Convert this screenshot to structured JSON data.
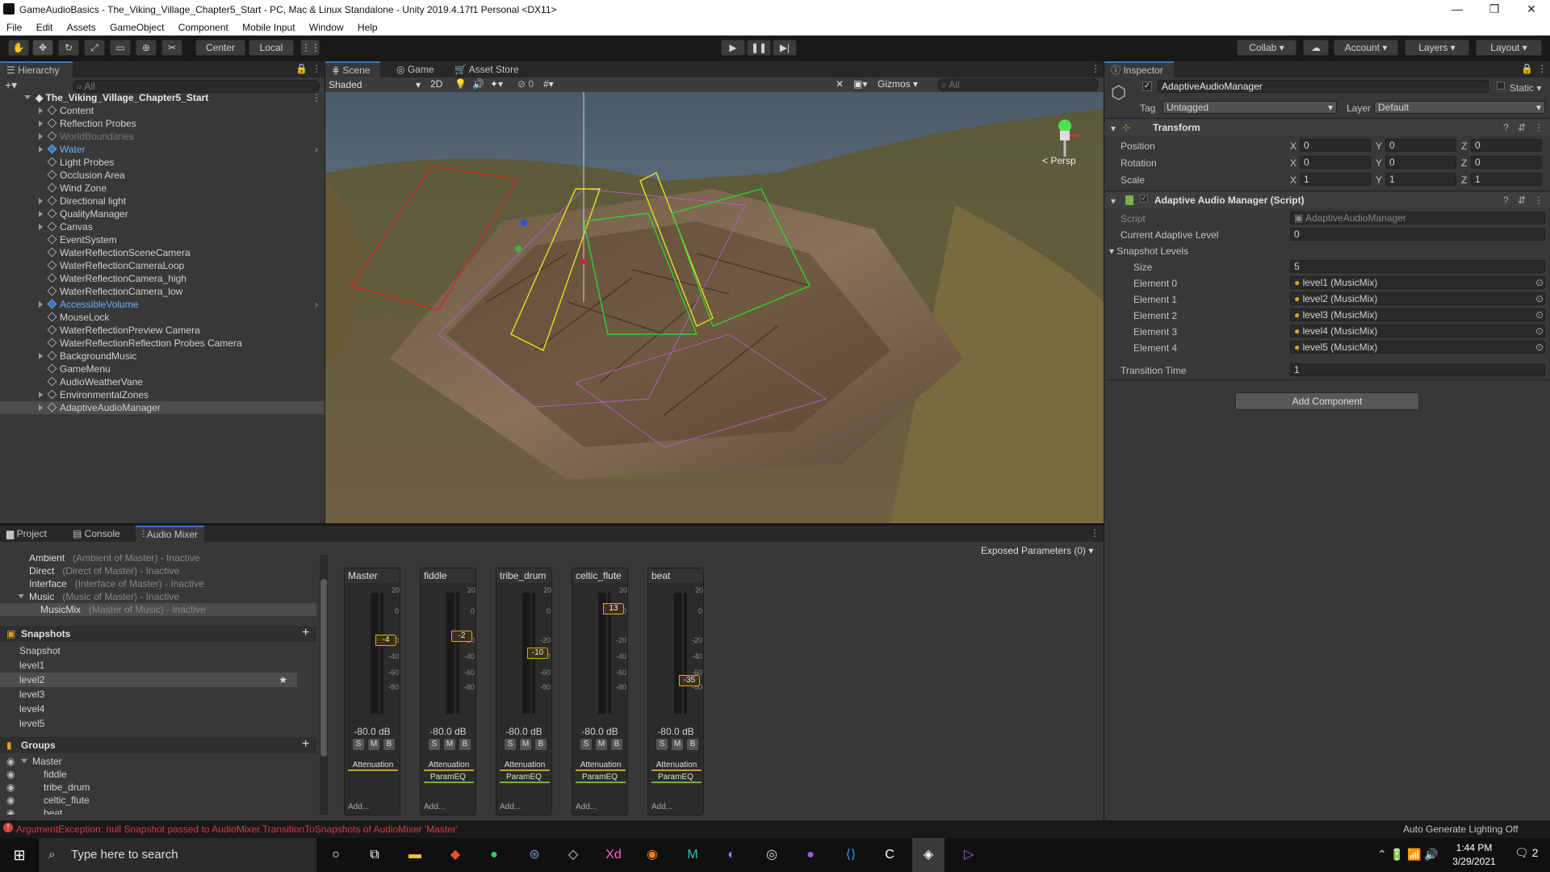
{
  "window": {
    "title": "GameAudioBasics - The_Viking_Village_Chapter5_Start - PC, Mac & Linux Standalone - Unity 2019.4.17f1 Personal <DX11>",
    "controls": [
      "—",
      "❐",
      "✕"
    ]
  },
  "menu": [
    "File",
    "Edit",
    "Assets",
    "GameObject",
    "Component",
    "Mobile Input",
    "Window",
    "Help"
  ],
  "toolbar": {
    "pivot": "Center",
    "space": "Local",
    "collab": "Collab",
    "account": "Account",
    "layers": "Layers",
    "layout": "Layout"
  },
  "hierarchy": {
    "tab": "Hierarchy",
    "search_placeholder": "All",
    "scene": "The_Viking_Village_Chapter5_Start",
    "items": [
      {
        "label": "Content",
        "expandable": true,
        "style": "normal"
      },
      {
        "label": "Reflection Probes",
        "expandable": true,
        "style": "normal"
      },
      {
        "label": "WorldBoundaries",
        "expandable": true,
        "style": "disabled"
      },
      {
        "label": "Water",
        "expandable": true,
        "style": "prefab"
      },
      {
        "label": "Light Probes",
        "expandable": false,
        "style": "normal"
      },
      {
        "label": "Occlusion Area",
        "expandable": false,
        "style": "normal"
      },
      {
        "label": "Wind Zone",
        "expandable": false,
        "style": "normal"
      },
      {
        "label": "Directional light",
        "expandable": true,
        "style": "normal"
      },
      {
        "label": "QualityManager",
        "expandable": true,
        "style": "normal"
      },
      {
        "label": "Canvas",
        "expandable": true,
        "style": "normal"
      },
      {
        "label": "EventSystem",
        "expandable": false,
        "style": "normal"
      },
      {
        "label": "WaterReflectionSceneCamera",
        "expandable": false,
        "style": "normal"
      },
      {
        "label": "WaterReflectionCameraLoop",
        "expandable": false,
        "style": "normal"
      },
      {
        "label": "WaterReflectionCamera_high",
        "expandable": false,
        "style": "normal"
      },
      {
        "label": "WaterReflectionCamera_low",
        "expandable": false,
        "style": "normal"
      },
      {
        "label": "AccessibleVolume",
        "expandable": true,
        "style": "prefab"
      },
      {
        "label": "MouseLock",
        "expandable": false,
        "style": "normal"
      },
      {
        "label": "WaterReflectionPreview Camera",
        "expandable": false,
        "style": "normal"
      },
      {
        "label": "WaterReflectionReflection Probes Camera",
        "expandable": false,
        "style": "normal"
      },
      {
        "label": "BackgroundMusic",
        "expandable": true,
        "style": "normal"
      },
      {
        "label": "GameMenu",
        "expandable": false,
        "style": "normal"
      },
      {
        "label": "AudioWeatherVane",
        "expandable": false,
        "style": "normal"
      },
      {
        "label": "EnvironmentalZones",
        "expandable": true,
        "style": "normal"
      },
      {
        "label": "AdaptiveAudioManager",
        "expandable": true,
        "style": "selected"
      }
    ]
  },
  "scene_view": {
    "tabs": [
      "Scene",
      "Game",
      "Asset Store"
    ],
    "shading": "Shaded",
    "mode_2d": "2D",
    "hidden_count": "0",
    "gizmos": "Gizmos",
    "search_placeholder": "All",
    "persp": "< Persp"
  },
  "inspector": {
    "tab": "Inspector",
    "object_name": "AdaptiveAudioManager",
    "static_label": "Static",
    "tag_label": "Tag",
    "tag_value": "Untagged",
    "layer_label": "Layer",
    "layer_value": "Default",
    "transform": {
      "title": "Transform",
      "rows": [
        {
          "label": "Position",
          "x": "0",
          "y": "0",
          "z": "0"
        },
        {
          "label": "Rotation",
          "x": "0",
          "y": "0",
          "z": "0"
        },
        {
          "label": "Scale",
          "x": "1",
          "y": "1",
          "z": "1"
        }
      ]
    },
    "script_component": {
      "title": "Adaptive Audio Manager (Script)",
      "script_label": "Script",
      "script_value": "AdaptiveAudioManager",
      "level_label": "Current Adaptive Level",
      "level_value": "0",
      "snapshot_label": "Snapshot Levels",
      "size_label": "Size",
      "size_value": "5",
      "elements": [
        {
          "label": "Element 0",
          "value": "level1 (MusicMix)"
        },
        {
          "label": "Element 1",
          "value": "level2 (MusicMix)"
        },
        {
          "label": "Element 2",
          "value": "level3 (MusicMix)"
        },
        {
          "label": "Element 3",
          "value": "level4 (MusicMix)"
        },
        {
          "label": "Element 4",
          "value": "level5 (MusicMix)"
        }
      ],
      "transition_label": "Transition Time",
      "transition_value": "1"
    },
    "add_component": "Add Component"
  },
  "bottom_tabs": [
    "Project",
    "Console",
    "Audio Mixer"
  ],
  "audio_mixer": {
    "exposed_params": "Exposed Parameters (0)",
    "mixers": [
      {
        "name": "Ambient",
        "desc": "(Ambient of Master) - Inactive"
      },
      {
        "name": "Direct",
        "desc": "(Direct of Master) - Inactive"
      },
      {
        "name": "Interface",
        "desc": "(Interface of Master) - Inactive"
      },
      {
        "name": "Music",
        "desc": "(Music of Master) - Inactive"
      },
      {
        "name": "MusicMix",
        "desc": "(Master of Music) - Inactive"
      }
    ],
    "snapshots_title": "Snapshots",
    "snapshots": [
      "Snapshot",
      "level1",
      "level2",
      "level3",
      "level4",
      "level5"
    ],
    "groups_title": "Groups",
    "groups": [
      "Master",
      "fiddle",
      "tribe_drum",
      "celtic_flute",
      "beat"
    ],
    "strips": [
      {
        "name": "Master",
        "fader": "-4",
        "db": "-80.0 dB",
        "effects": [
          "Attenuation"
        ]
      },
      {
        "name": "fiddle",
        "fader": "-2",
        "db": "-80.0 dB",
        "effects": [
          "Attenuation",
          "ParamEQ"
        ]
      },
      {
        "name": "tribe_drum",
        "fader": "-10",
        "db": "-80.0 dB",
        "effects": [
          "Attenuation",
          "ParamEQ"
        ]
      },
      {
        "name": "celtic_flute",
        "fader": "13",
        "db": "-80.0 dB",
        "effects": [
          "Attenuation",
          "ParamEQ"
        ]
      },
      {
        "name": "beat",
        "fader": "-35",
        "db": "-80.0 dB",
        "effects": [
          "Attenuation",
          "ParamEQ"
        ]
      }
    ],
    "scale": [
      "20",
      "0",
      "-20",
      "-40",
      "-60",
      "-80"
    ],
    "smb": [
      "S",
      "M",
      "B"
    ],
    "add_label": "Add..."
  },
  "status": {
    "error": "ArgumentException: null Snapshot passed to AudioMixer.TransitionToSnapshots of AudioMixer 'Master'",
    "lighting": "Auto Generate Lighting Off"
  },
  "taskbar": {
    "search_placeholder": "Type here to search",
    "time": "1:44 PM",
    "date": "3/29/2021",
    "notifications": "2"
  },
  "colors": {
    "selection_blue": "#3a79bb",
    "prefab_blue": "#6ab0ff",
    "fader_gold": "#e0a820",
    "error_red": "#d04040"
  }
}
